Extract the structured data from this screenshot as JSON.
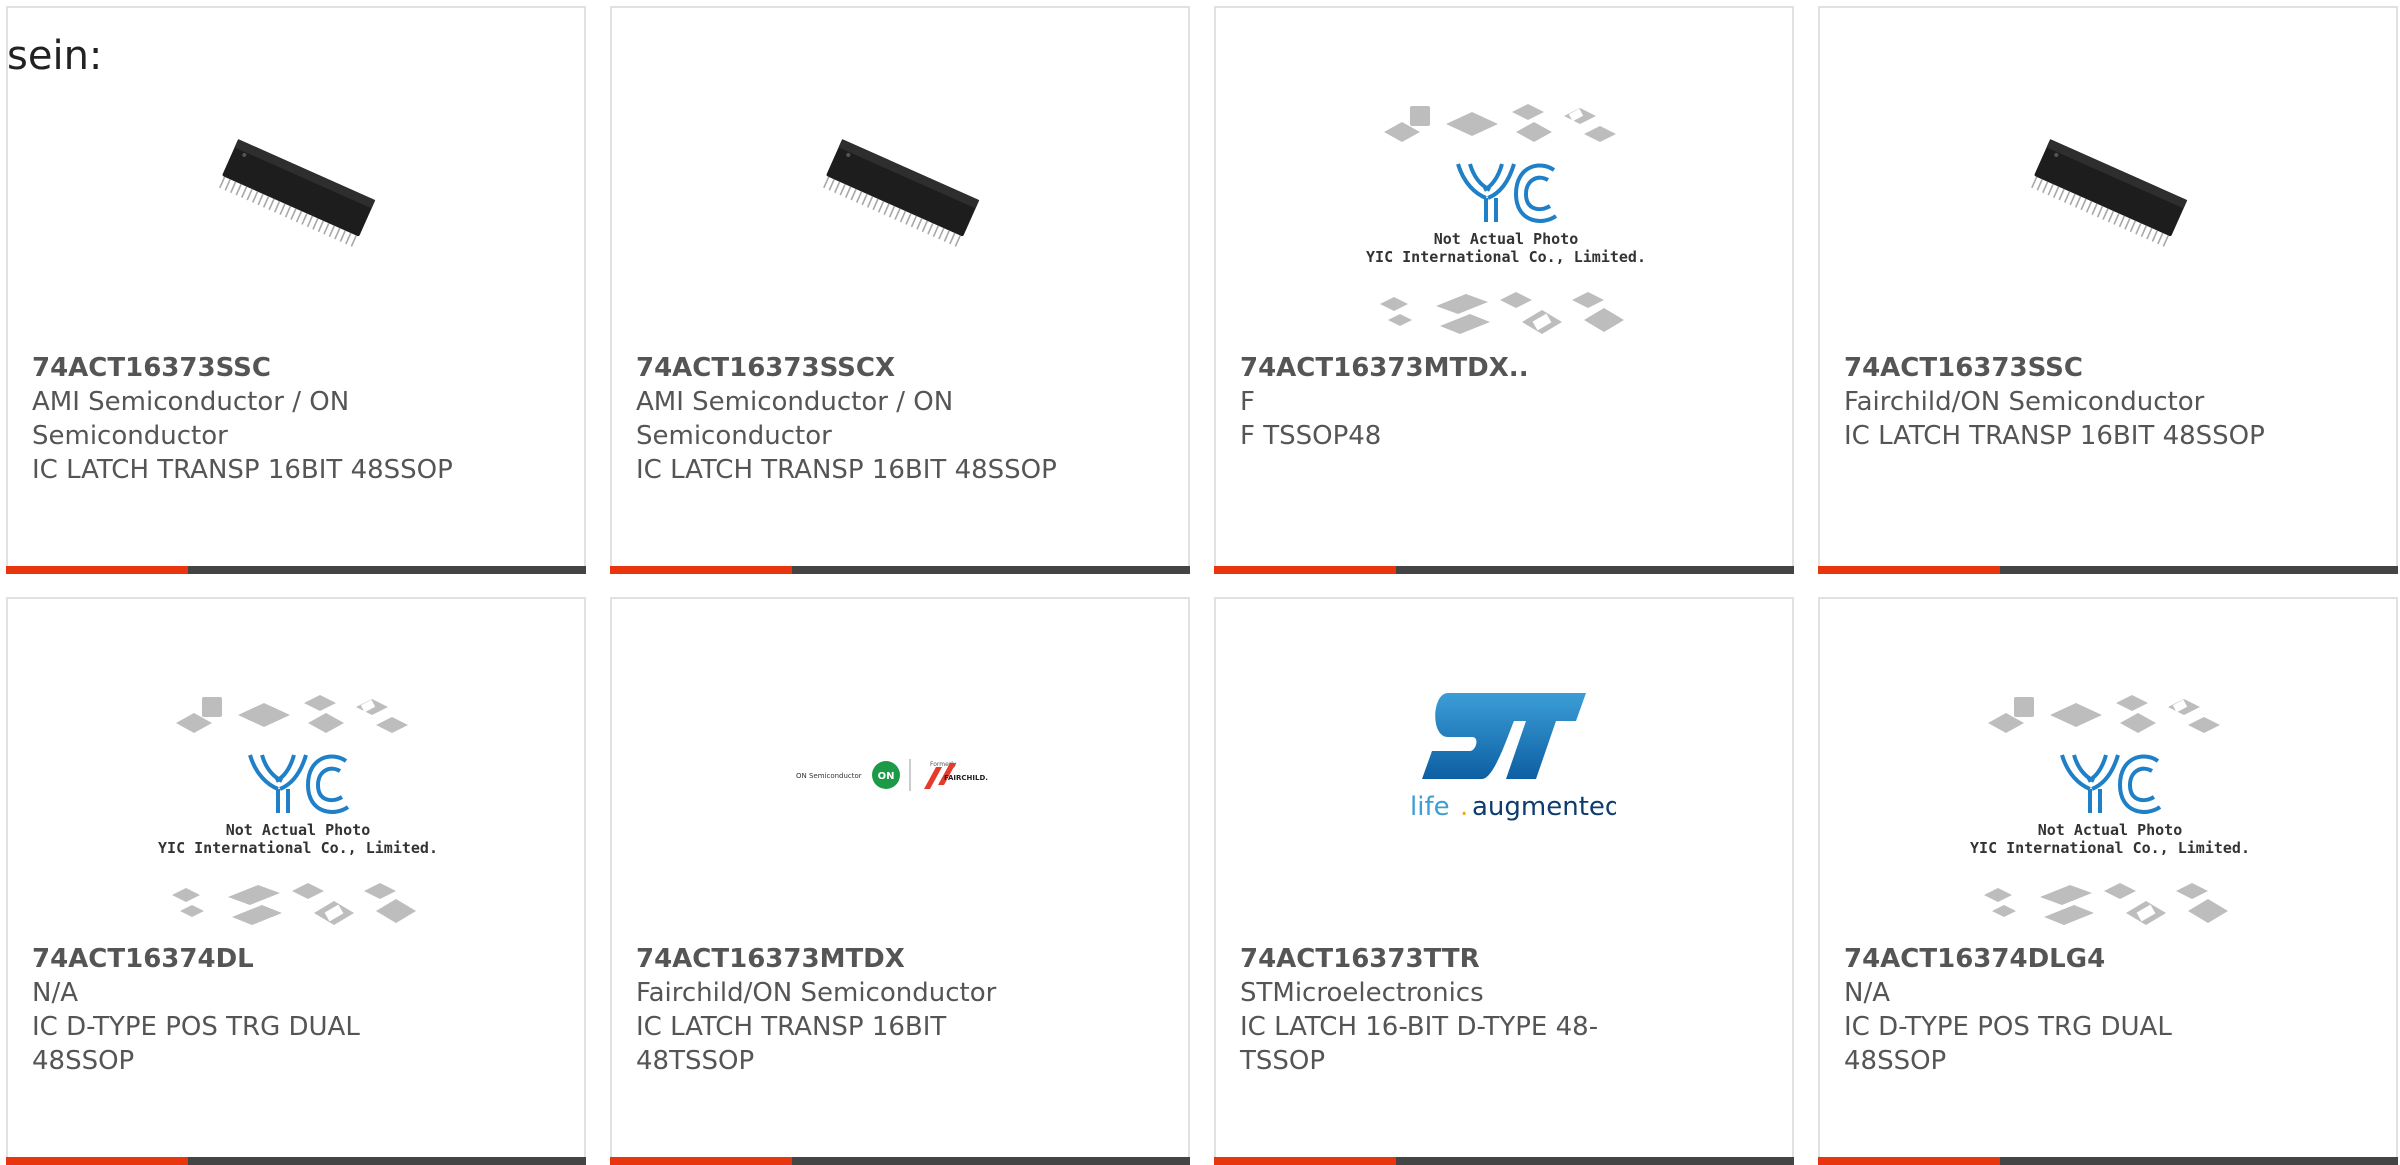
{
  "intro": {
    "text": "sein:"
  },
  "colors": {
    "accent_bar": "#e8350e",
    "dark_bar": "#444444",
    "card_text": "#555555",
    "card_border": "#e1e1e1"
  },
  "products": [
    {
      "part_number": "74ACT16373SSC",
      "manufacturer": "AMI Semiconductor / ON Semiconductor",
      "manufacturer_line1": "AMI Semiconductor / ON",
      "manufacturer_line2": "Semiconductor",
      "description": "IC LATCH TRANSP 16BIT 48SSOP",
      "image": "chip-photo"
    },
    {
      "part_number": "74ACT16373SSCX",
      "manufacturer": "AMI Semiconductor / ON Semiconductor",
      "manufacturer_line1": "AMI Semiconductor / ON",
      "manufacturer_line2": "Semiconductor",
      "description": "IC LATCH TRANSP 16BIT 48SSOP",
      "image": "chip-photo"
    },
    {
      "part_number": "74ACT16373MTDX..",
      "manufacturer": "F",
      "description": "F TSSOP48",
      "image": "yic-placeholder",
      "placeholder_line1": "Not Actual Photo",
      "placeholder_line2": "YIC International Co., Limited."
    },
    {
      "part_number": "74ACT16373SSC",
      "manufacturer": "Fairchild/ON Semiconductor",
      "description": "IC LATCH TRANSP 16BIT 48SSOP",
      "image": "chip-photo"
    },
    {
      "part_number": "74ACT16374DL",
      "manufacturer": "N/A",
      "description_line1": "IC D-TYPE POS TRG DUAL",
      "description_line2": "48SSOP",
      "image": "yic-placeholder",
      "placeholder_line1": "Not Actual Photo",
      "placeholder_line2": "YIC International Co., Limited."
    },
    {
      "part_number": "74ACT16373MTDX",
      "manufacturer": "Fairchild/ON Semiconductor",
      "description_line1": "IC LATCH TRANSP 16BIT",
      "description_line2": "48TSSOP",
      "image": "onsemi-fairchild-logo",
      "logo_text_left": "ON Semiconductor",
      "logo_text_on": "ON",
      "logo_text_formerly": "Formerly",
      "logo_text_fairchild": "FAIRCHILD."
    },
    {
      "part_number": "74ACT16373TTR",
      "manufacturer": "STMicroelectronics",
      "description_line1": "IC LATCH 16-BIT D-TYPE 48-",
      "description_line2": "TSSOP",
      "image": "st-logo",
      "logo_text_life": "life",
      "logo_text_dot": ".",
      "logo_text_augmented": "augmented"
    },
    {
      "part_number": "74ACT16374DLG4",
      "manufacturer": "N/A",
      "description_line1": "IC D-TYPE POS TRG DUAL",
      "description_line2": "48SSOP",
      "image": "yic-placeholder",
      "placeholder_line1": "Not Actual Photo",
      "placeholder_line2": "YIC International Co., Limited."
    }
  ]
}
